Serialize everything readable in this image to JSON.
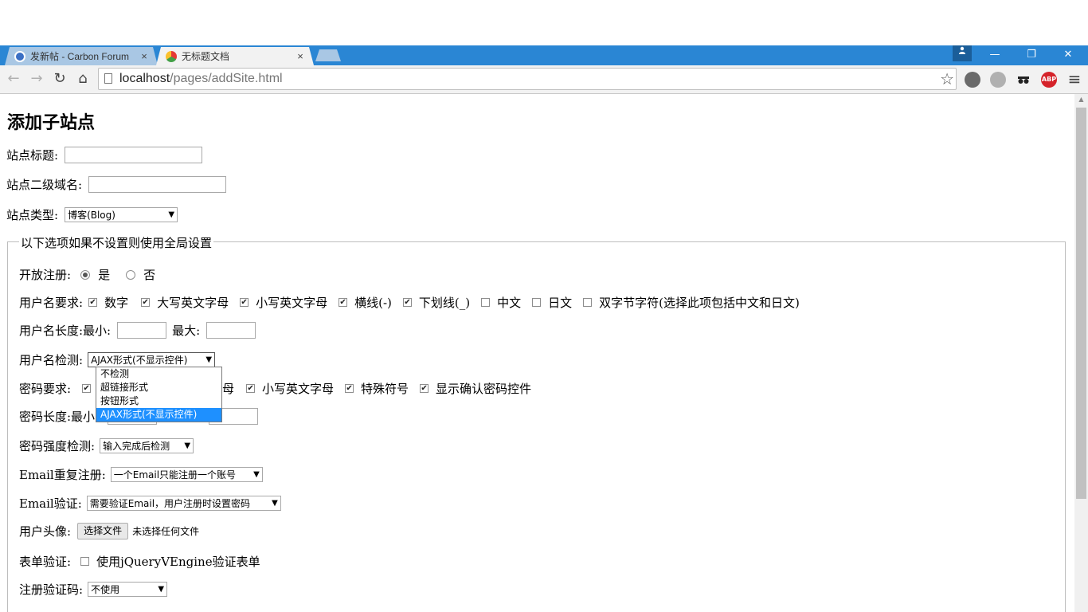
{
  "browser": {
    "tabs": [
      {
        "title": "发新帖 - Carbon Forum",
        "close": "×",
        "active": false
      },
      {
        "title": "无标题文档",
        "close": "×",
        "active": true
      }
    ],
    "window_buttons": {
      "minimize": "—",
      "restore": "❐",
      "close": "✕"
    },
    "url_host": "localhost",
    "url_path": "/pages/addSite.html",
    "nav": {
      "back": "←",
      "forward": "→",
      "reload": "↻",
      "home": "⌂"
    },
    "star": "☆",
    "menu": "≡",
    "abp_label": "ABP"
  },
  "page": {
    "heading": "添加子站点",
    "site_title_label": "站点标题:",
    "subdomain_label": "站点二级域名:",
    "site_type_label": "站点类型:",
    "site_type_value": "博客(Blog)",
    "legend": "以下选项如果不设置则使用全局设置",
    "open_reg_label": "开放注册:",
    "open_reg_yes": "是",
    "open_reg_no": "否",
    "username_req_label": "用户名要求:",
    "username_req_options": [
      {
        "label": "数字",
        "checked": true
      },
      {
        "label": "大写英文字母",
        "checked": true
      },
      {
        "label": "小写英文字母",
        "checked": true
      },
      {
        "label": "横线(-)",
        "checked": true
      },
      {
        "label": "下划线(_)",
        "checked": true
      },
      {
        "label": "中文",
        "checked": false
      },
      {
        "label": "日文",
        "checked": false
      },
      {
        "label": "双字节字符(选择此项包括中文和日文)",
        "checked": false
      }
    ],
    "username_len_label": "用户名长度:最小:",
    "username_len_max_label": "最大:",
    "username_check_label": "用户名检测:",
    "username_check_value": "AJAX形式(不显示控件)",
    "username_check_options": [
      "不检测",
      "超链接形式",
      "按钮形式",
      "AJAX形式(不显示控件)"
    ],
    "password_req_label": "密码要求:",
    "password_req_visible": [
      {
        "label": "母",
        "checked": null
      },
      {
        "label": "小写英文字母",
        "checked": true
      },
      {
        "label": "特殊符号",
        "checked": true
      },
      {
        "label": "显示确认密码控件",
        "checked": true
      }
    ],
    "password_len_label": "密码长度:最小",
    "password_strength_label": "密码强度检测:",
    "password_strength_value": "输入完成后检测",
    "email_repeat_label": "Email重复注册:",
    "email_repeat_value": "一个Email只能注册一个账号",
    "email_verify_label": "Email验证:",
    "email_verify_value": "需要验证Email，用户注册时设置密码",
    "avatar_label": "用户头像:",
    "file_button": "选择文件",
    "file_status": "未选择任何文件",
    "form_validate_label": "表单验证:",
    "form_validate_option": "使用jQueryVEngine验证表单",
    "captcha_label": "注册验证码:",
    "captcha_value": "不使用",
    "check_mark": "✔",
    "caret": "▼"
  }
}
